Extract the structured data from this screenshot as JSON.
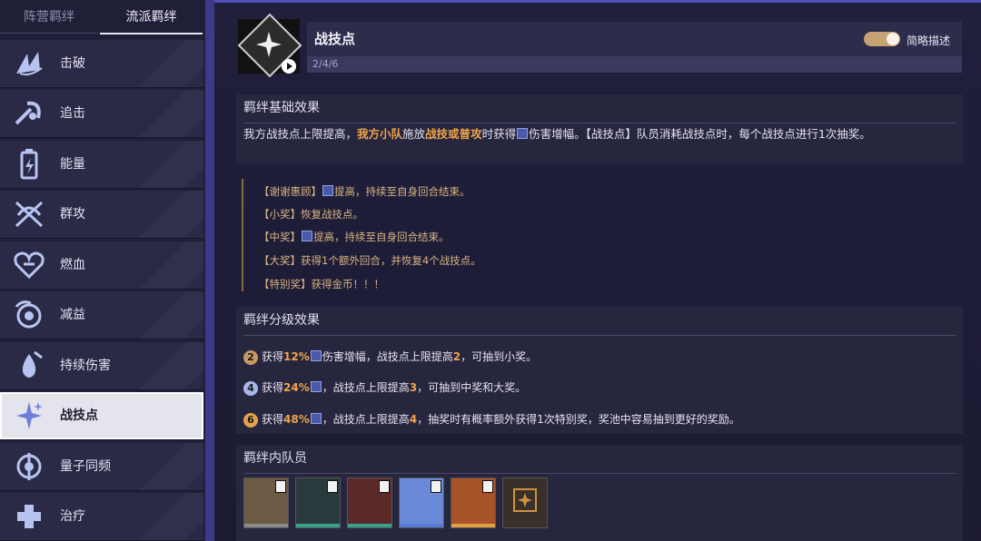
{
  "tabs": [
    "阵营羁绊",
    "流派羁绊"
  ],
  "sidebar": {
    "items": [
      {
        "label": "击破",
        "icon": "wing-icon"
      },
      {
        "label": "追击",
        "icon": "pursuit-icon"
      },
      {
        "label": "能量",
        "icon": "energy-battery-icon"
      },
      {
        "label": "群攻",
        "icon": "aoe-crossbow-icon"
      },
      {
        "label": "燃血",
        "icon": "heart-icon"
      },
      {
        "label": "减益",
        "icon": "debuff-swirl-icon"
      },
      {
        "label": "持续伤害",
        "icon": "dot-drop-icon"
      },
      {
        "label": "战技点",
        "icon": "skill-point-star-icon"
      },
      {
        "label": "量子同频",
        "icon": "quantum-icon"
      },
      {
        "label": "治疗",
        "icon": "heal-cross-icon"
      }
    ],
    "selected_index": 7
  },
  "header": {
    "title": "战技点",
    "progress": "2/4/6",
    "toggle_label": "简略描述",
    "toggle_on": true
  },
  "basic": {
    "heading": "羁绊基础效果",
    "p1": "我方战技点上限提高，",
    "p1_hl1": "我方小队",
    "p1_mid": "施放",
    "p1_hl2": "战技或普攻",
    "p1_end": "时获得",
    "p1_tail": "伤害增幅。【战技点】队员消耗战技点时，每个战技点进行1次抽奖。",
    "prizes": [
      {
        "pre": "【谢谢惠顾】",
        "post": "提高，持续至自身回合结束。",
        "icon": true
      },
      {
        "pre": "【小奖】恢复战技点。",
        "post": "",
        "icon": false
      },
      {
        "pre": "【中奖】",
        "post": "提高，持续至自身回合结束。",
        "icon": true
      },
      {
        "pre": "【大奖】获得1个额外回合，并恢复4个战技点。",
        "post": "",
        "icon": false
      },
      {
        "pre": "【特别奖】获得金币！！！",
        "post": "",
        "icon": false
      }
    ]
  },
  "levels": {
    "heading": "羁绊分级效果",
    "rows": [
      {
        "n": "2",
        "color": "#c89a62",
        "a": "获得",
        "pct": "12%",
        "b": "伤害增幅，战技点上限提高",
        "up": "2",
        "c": "，可抽到小奖。"
      },
      {
        "n": "4",
        "color": "#a9b7e8",
        "a": "获得",
        "pct": "24%",
        "b": "，战技点上限提高",
        "up": "3",
        "c": "，可抽到中奖和大奖。"
      },
      {
        "n": "6",
        "color": "#e2a24a",
        "a": "获得",
        "pct": "48%",
        "b": "，战技点上限提高",
        "up": "4",
        "c": "，抽奖时有概率额外获得1次特别奖，奖池中容易抽到更好的奖励。"
      }
    ]
  },
  "members": {
    "heading": "羁绊内队员",
    "list": [
      {
        "icon": "member-portrait-icon",
        "bar": "#8a8a8a",
        "bg": "#6d5a44"
      },
      {
        "icon": "member-portrait-icon",
        "bar": "#3aa08a",
        "bg": "#2a3a3c"
      },
      {
        "icon": "member-portrait-icon",
        "bar": "#3aa08a",
        "bg": "#5a2a2a"
      },
      {
        "icon": "member-portrait-icon",
        "bar": "#5a7ad8",
        "bg": "#6a8ad8"
      },
      {
        "icon": "member-portrait-icon",
        "bar": "#e0a040",
        "bg": "#a8522a"
      },
      {
        "icon": "add-member-slot-icon",
        "bar": "#3a3a3a",
        "bg": "#3a302a"
      }
    ]
  }
}
